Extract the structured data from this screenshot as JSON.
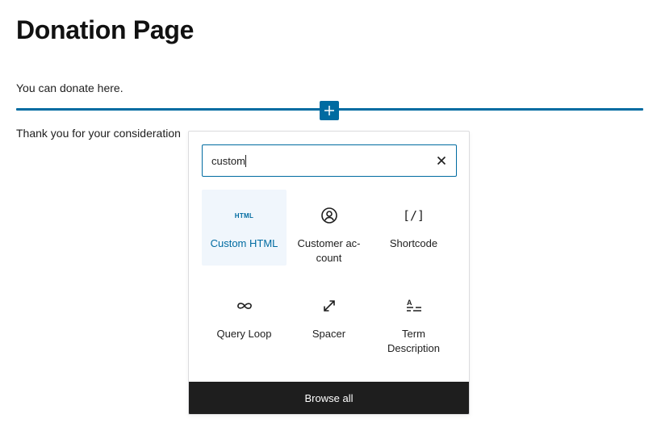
{
  "page": {
    "title": "Donation Page",
    "paragraphs": [
      "You can donate here.",
      "Thank you for your consideration"
    ]
  },
  "inserter": {
    "toggle_icon": "plus-icon",
    "accent_color": "#006ba1",
    "search": {
      "value": "custom",
      "clear_icon": "close-icon"
    },
    "results": [
      {
        "label": "Custom HTML",
        "icon": "html-icon",
        "icon_text": "HTML",
        "selected": true
      },
      {
        "label": "Customer ac-\ncount",
        "icon": "user-circle-icon",
        "selected": false
      },
      {
        "label": "Shortcode",
        "icon": "shortcode-icon",
        "icon_text": "[/]",
        "selected": false
      },
      {
        "label": "Query Loop",
        "icon": "loop-icon",
        "selected": false
      },
      {
        "label": "Spacer",
        "icon": "resize-icon",
        "selected": false
      },
      {
        "label": "Term\nDescription",
        "icon": "term-description-icon",
        "selected": false
      }
    ],
    "browse_all_label": "Browse all"
  }
}
